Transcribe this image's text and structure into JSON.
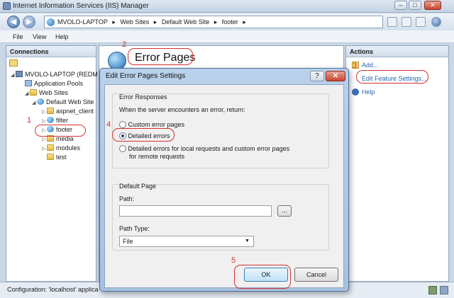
{
  "window": {
    "title": "Internet Information Services (IIS) Manager",
    "buttons": {
      "minimize": "–",
      "maximize": "□",
      "close": "✕"
    }
  },
  "address": {
    "back_icon": "back-arrow-icon",
    "forward_icon": "forward-arrow-icon",
    "crumbs": [
      "MVOLO-LAPTOP",
      "▸",
      "Web Sites",
      "▸",
      "Default Web Site",
      "▸",
      "footer",
      "▸"
    ]
  },
  "menu": [
    "File",
    "View",
    "Help"
  ],
  "connections": {
    "header": "Connections",
    "tree": [
      {
        "label": "MVOLO-LAPTOP (REDM",
        "icon": "computer-icon",
        "toggle": "◢"
      },
      {
        "label": "Application Pools",
        "icon": "app-pools-icon",
        "toggle": ""
      },
      {
        "label": "Web Sites",
        "icon": "folder-icon",
        "toggle": "◢"
      },
      {
        "label": "Default Web Site",
        "icon": "globe-icon",
        "toggle": "◢"
      },
      {
        "label": "aspnet_client",
        "icon": "folder-icon",
        "toggle": "▷"
      },
      {
        "label": "filter",
        "icon": "globe-icon",
        "toggle": "▷"
      },
      {
        "label": "footer",
        "icon": "globe-icon",
        "toggle": "▷"
      },
      {
        "label": "media",
        "icon": "folder-icon",
        "toggle": "▷"
      },
      {
        "label": "modules",
        "icon": "folder-icon",
        "toggle": "▷"
      },
      {
        "label": "test",
        "icon": "folder-icon",
        "toggle": "▷"
      }
    ]
  },
  "main": {
    "title": "Error Pages",
    "icon": "error-pages-globe-icon"
  },
  "actions": {
    "header": "Actions",
    "items": [
      "Add...",
      "Edit Feature Settings...",
      "Help"
    ]
  },
  "callouts": [
    "1",
    "2",
    "3",
    "4",
    "5"
  ],
  "dialog": {
    "title": "Edit Error Pages Settings",
    "help": "?",
    "close": "✕",
    "error_responses": {
      "legend": "Error Responses",
      "prompt": "When the server encounters an error, return:",
      "options": [
        "Custom error pages",
        "Detailed errors",
        "Detailed errors for local requests and custom error pages",
        "for remote requests"
      ],
      "selected": "Detailed errors"
    },
    "default_page": {
      "legend": "Default Page",
      "path_label": "Path:",
      "path_value": "",
      "browse": "...",
      "path_type_label": "Path Type:",
      "path_type_value": "File"
    },
    "ok": "OK",
    "cancel": "Cancel"
  },
  "status": {
    "text": "Configuration: 'localhost' applica"
  }
}
